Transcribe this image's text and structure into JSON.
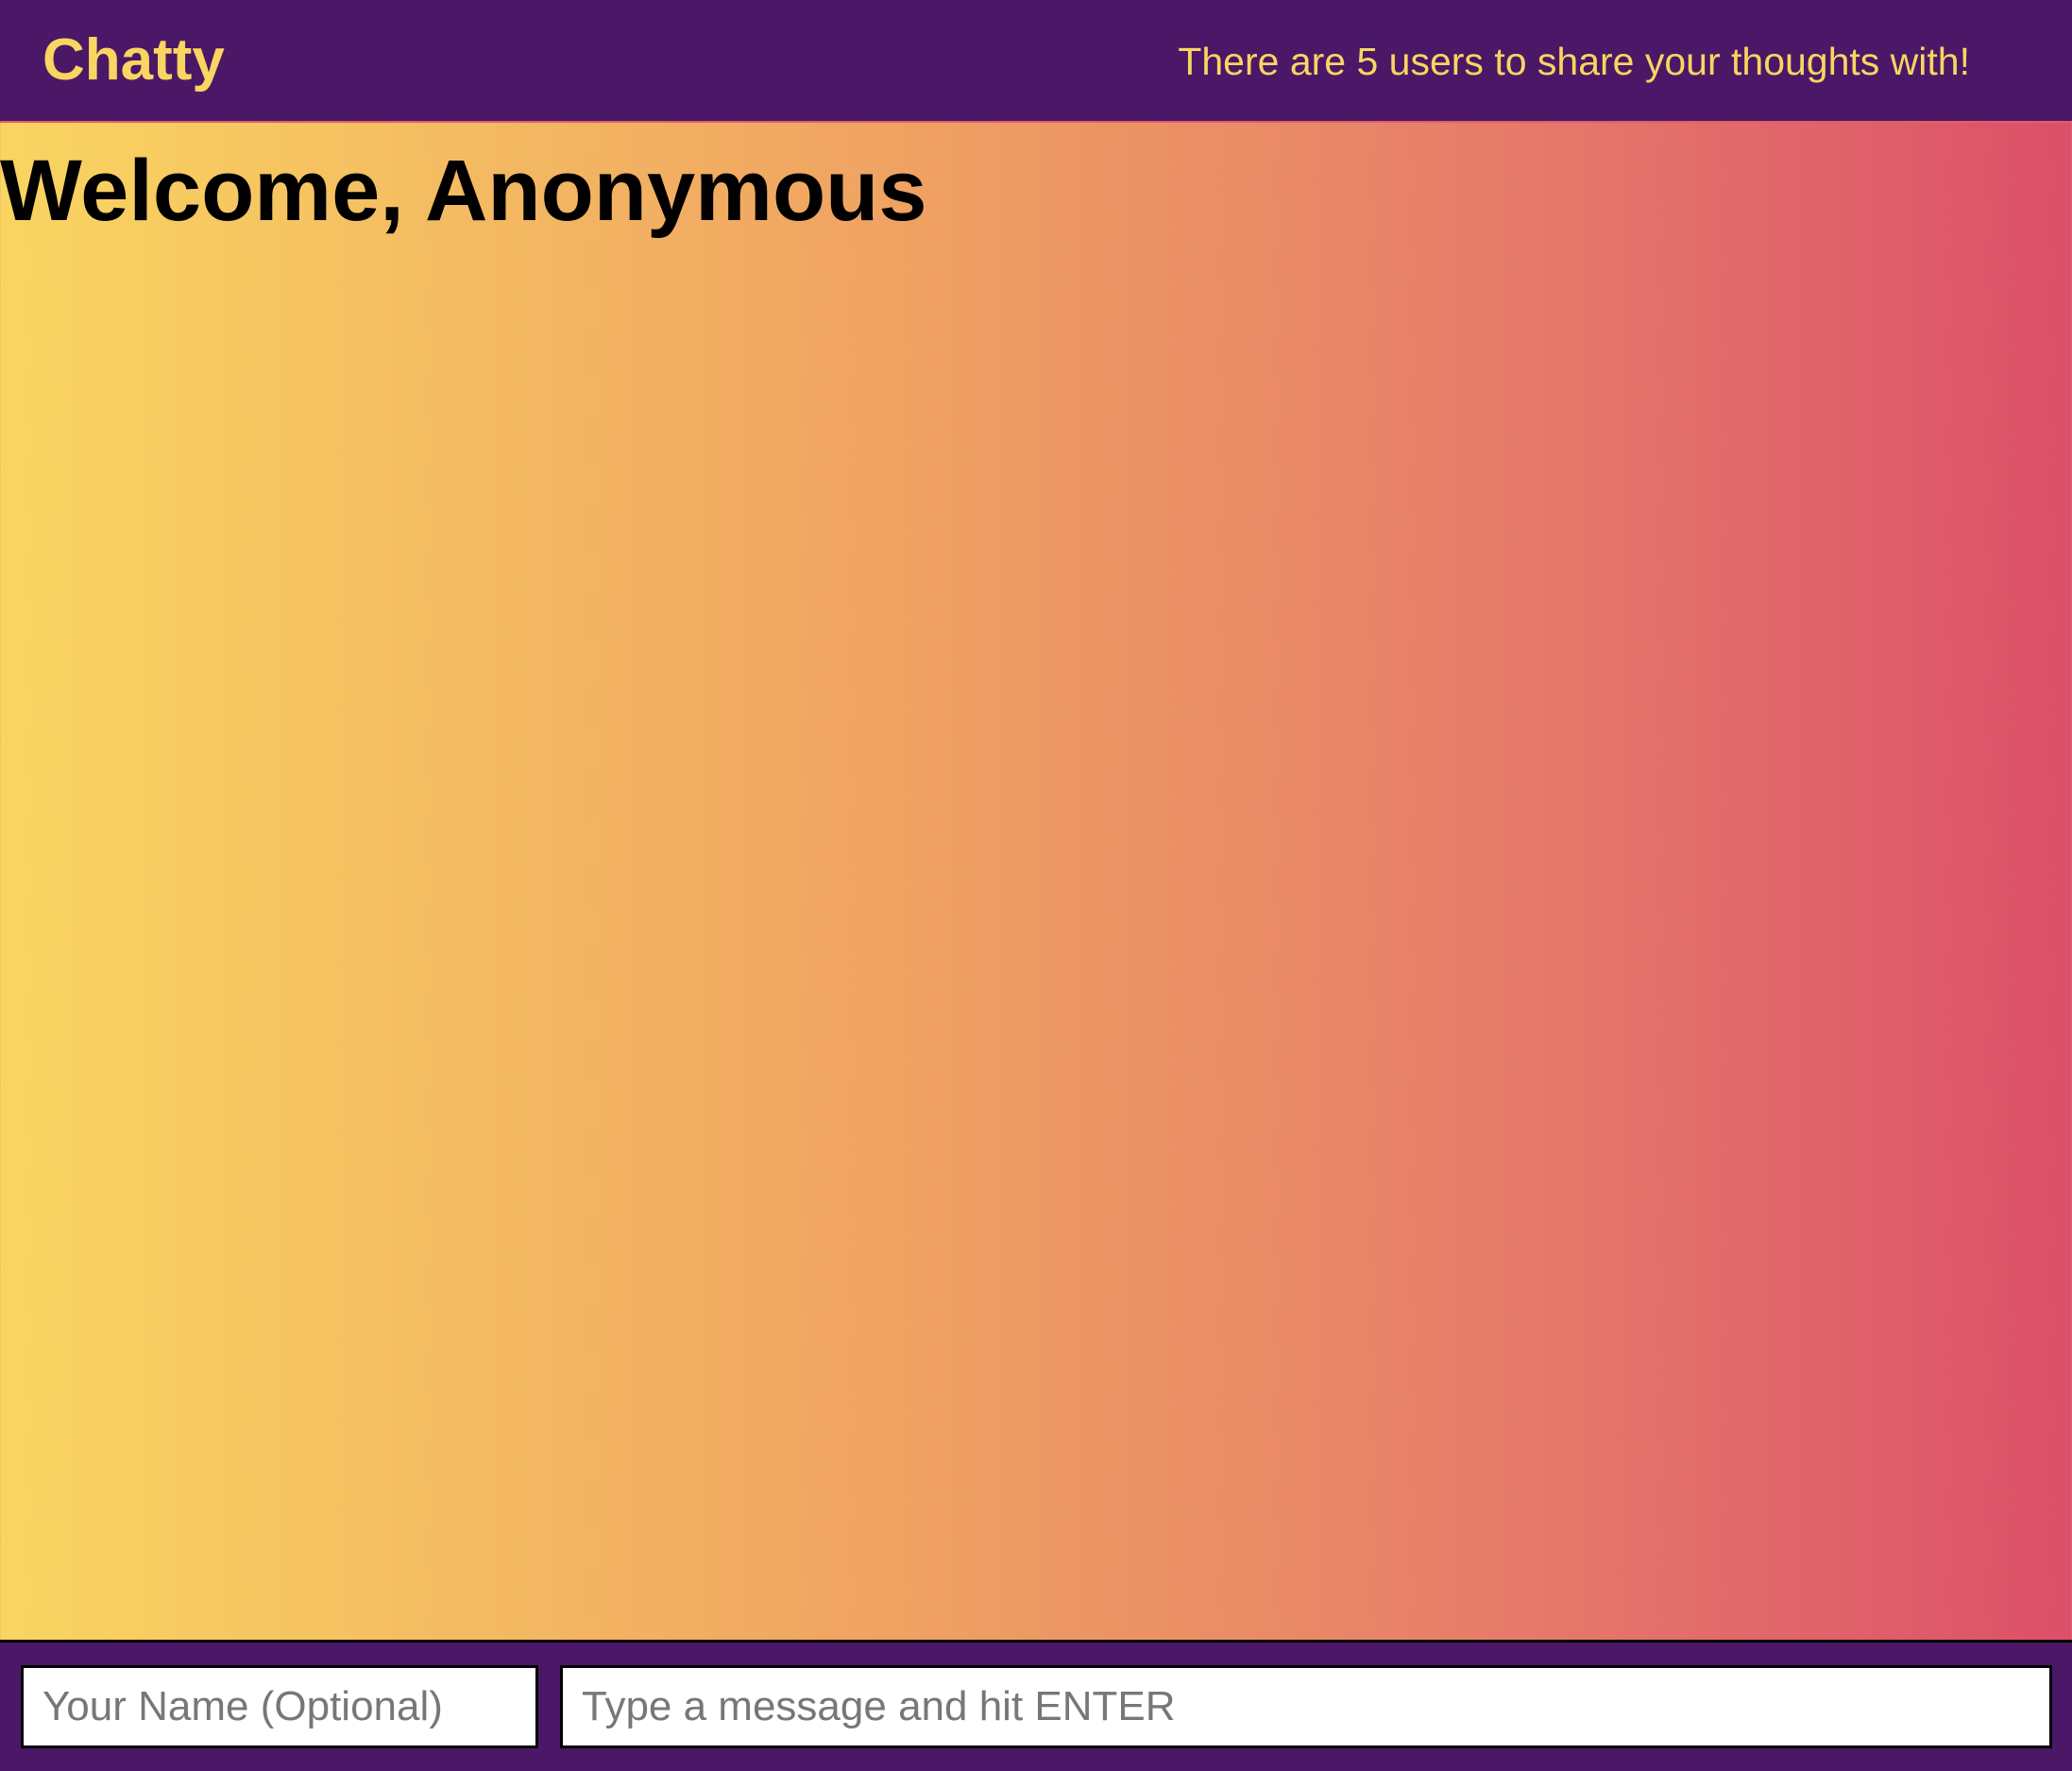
{
  "header": {
    "title": "Chatty",
    "user_count_text": "There are 5 users to share your thoughts with!"
  },
  "main": {
    "welcome": "Welcome, Anonymous"
  },
  "footer": {
    "name_placeholder": "Your Name (Optional)",
    "message_placeholder": "Type a message and hit ENTER"
  },
  "colors": {
    "nav": "#4b1867",
    "accent": "#f9d561",
    "gradient_start": "#f9d561",
    "gradient_end": "#dc4f69"
  }
}
